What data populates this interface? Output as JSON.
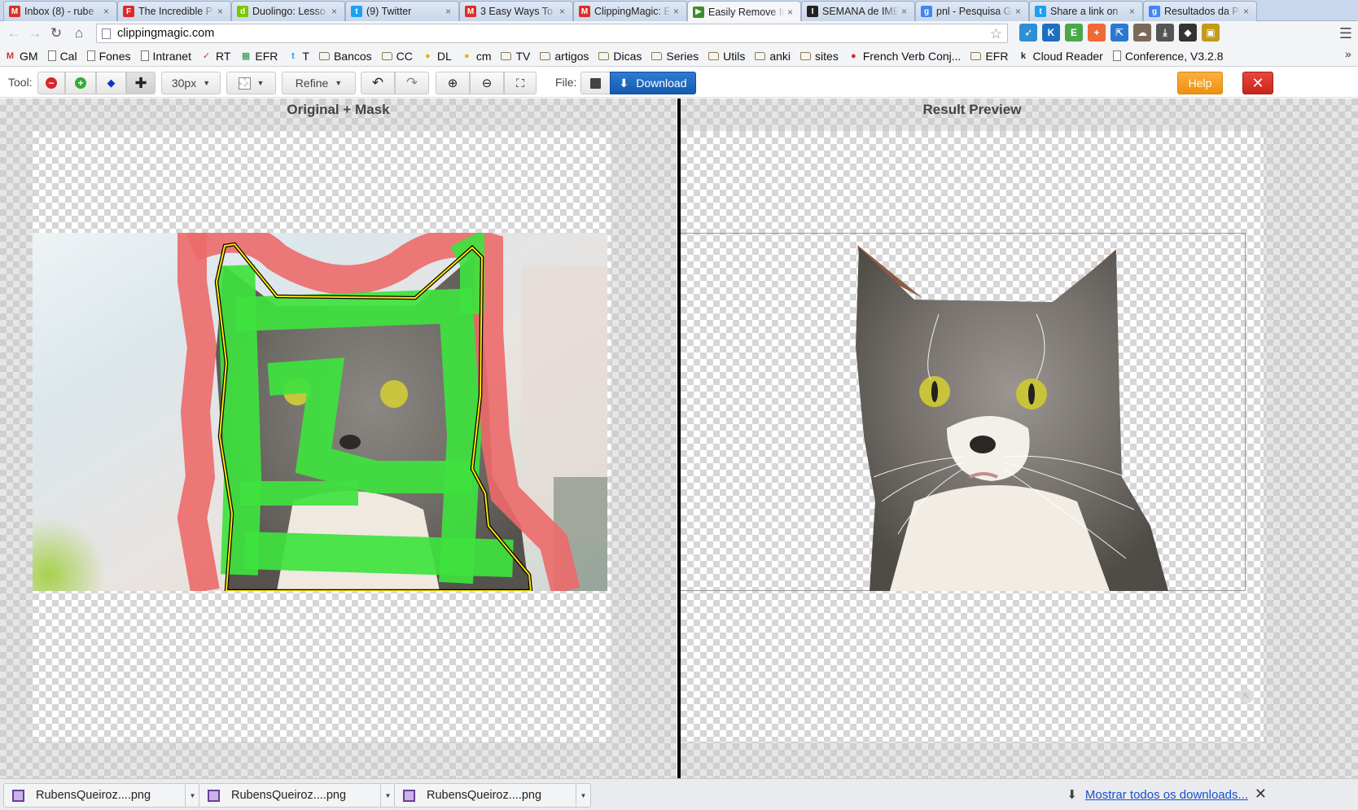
{
  "browser": {
    "tabs": [
      {
        "title": "Inbox (8) - rube",
        "icon": "gmail-icon",
        "color": "#d93025",
        "glyph": "M"
      },
      {
        "title": "The Incredible P",
        "icon": "flipboard-icon",
        "color": "#e12828",
        "glyph": "F"
      },
      {
        "title": "Duolingo: Lesso",
        "icon": "duolingo-icon",
        "color": "#78c800",
        "glyph": "d"
      },
      {
        "title": "(9) Twitter",
        "icon": "twitter-icon",
        "color": "#1da1f2",
        "glyph": "t"
      },
      {
        "title": "3 Easy Ways To",
        "icon": "gmail-icon",
        "color": "#d93025",
        "glyph": "M"
      },
      {
        "title": "ClippingMagic: E",
        "icon": "gmail-icon",
        "color": "#d93025",
        "glyph": "M"
      },
      {
        "title": "Easily Remove Ir",
        "icon": "play-icon",
        "color": "#3c8d2e",
        "glyph": "▶",
        "active": true
      },
      {
        "title": "SEMANA de IME",
        "icon": "ime-icon",
        "color": "#222222",
        "glyph": "I"
      },
      {
        "title": "pnl - Pesquisa G",
        "icon": "google-icon",
        "color": "#4285f4",
        "glyph": "g"
      },
      {
        "title": "Share a link on",
        "icon": "twitter-icon",
        "color": "#1da1f2",
        "glyph": "t"
      },
      {
        "title": "Resultados da P",
        "icon": "google-icon",
        "color": "#4285f4",
        "glyph": "g"
      }
    ],
    "url": "clippingmagic.com",
    "extensions": [
      {
        "name": "twitter-ext-icon",
        "glyph": "➶",
        "color": "#2d8fd5"
      },
      {
        "name": "k-ext-icon",
        "glyph": "K",
        "color": "#1f6fbf"
      },
      {
        "name": "evernote-ext-icon",
        "glyph": "E",
        "color": "#4aa84a"
      },
      {
        "name": "plus-ext-icon",
        "glyph": "+",
        "color": "#f06a35"
      },
      {
        "name": "share-ext-icon",
        "glyph": "⇱",
        "color": "#2a78d1"
      },
      {
        "name": "cloud-ext-icon",
        "glyph": "☁",
        "color": "#7a6a5a"
      },
      {
        "name": "download-ext-icon",
        "glyph": "⤓",
        "color": "#555555"
      },
      {
        "name": "tag-ext-icon",
        "glyph": "◆",
        "color": "#333333"
      },
      {
        "name": "stamp-ext-icon",
        "glyph": "▣",
        "color": "#c29b1a"
      }
    ]
  },
  "bookmarks": [
    {
      "label": "GM",
      "type": "gmail"
    },
    {
      "label": "Cal",
      "type": "page"
    },
    {
      "label": "Fones",
      "type": "page"
    },
    {
      "label": "Intranet",
      "type": "page"
    },
    {
      "label": "RT",
      "type": "check"
    },
    {
      "label": "EFR",
      "type": "sheet"
    },
    {
      "label": "T",
      "type": "twitter"
    },
    {
      "label": "Bancos",
      "type": "folder"
    },
    {
      "label": "CC",
      "type": "folder"
    },
    {
      "label": "DL",
      "type": "duolingo"
    },
    {
      "label": "cm",
      "type": "duolingo"
    },
    {
      "label": "TV",
      "type": "folder"
    },
    {
      "label": "artigos",
      "type": "folder"
    },
    {
      "label": "Dicas",
      "type": "folder"
    },
    {
      "label": "Series",
      "type": "folder"
    },
    {
      "label": "Utils",
      "type": "folder"
    },
    {
      "label": "anki",
      "type": "folder"
    },
    {
      "label": "sites",
      "type": "folder"
    },
    {
      "label": "French Verb Conj...",
      "type": "red"
    },
    {
      "label": "EFR",
      "type": "folder"
    },
    {
      "label": "Cloud Reader",
      "type": "kindle"
    },
    {
      "label": "Conference, V3.2.8",
      "type": "page"
    }
  ],
  "bookmarks_overflow": "»",
  "toolbar": {
    "tool_label": "Tool:",
    "brush_size": "30px",
    "refine_label": "Refine",
    "file_label": "File:",
    "download_label": "Download",
    "help_label": "Help",
    "close_glyph": "✕"
  },
  "panes": {
    "left_title": "Original + Mask",
    "right_title": "Result Preview"
  },
  "downloads": {
    "items": [
      "RubensQueiroz....png",
      "RubensQueiroz....png",
      "RubensQueiroz....png"
    ],
    "show_all": "Mostrar todos os downloads...",
    "close_glyph": "✕"
  },
  "colors": {
    "keep_mask": "#3ee23e",
    "remove_mask": "#ec6a6a",
    "outline": "#ffe600",
    "download_button": "#1a64bd",
    "help_button": "#f5a02a",
    "close_button": "#d8342b"
  }
}
